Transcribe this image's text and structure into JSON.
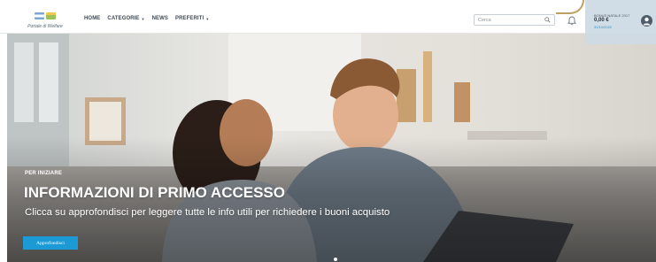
{
  "header": {
    "logo_text": "Portale di Welfare",
    "nav": [
      {
        "label": "HOME",
        "has_dropdown": false
      },
      {
        "label": "CATEGORIE",
        "has_dropdown": true
      },
      {
        "label": "NEWS",
        "has_dropdown": false
      },
      {
        "label": "PREFERITI",
        "has_dropdown": true
      }
    ],
    "search": {
      "placeholder": "Cerca",
      "value": ""
    },
    "icons": {
      "search": "search-icon",
      "notifications": "bell-icon",
      "user": "user-icon"
    },
    "bonus": {
      "title": "BONUS NATALE 2017",
      "amount": "0,00 €",
      "date": "31/10/2022"
    }
  },
  "hero": {
    "kicker": "PER INIZIARE",
    "title": "INFORMAZIONI DI PRIMO ACCESSO",
    "subtitle": "Clicca su approfondisci per leggere tutte le info utili per richiedere i buoni acquisto",
    "cta_label": "Approfondisci",
    "slide_indicator": "1"
  },
  "colors": {
    "accent_blue": "#1b9ad6",
    "nav_text": "#3f4a55",
    "bonus_panel": "#cedae4",
    "date_text": "#2a8fc1",
    "gold_accent": "#b89752"
  }
}
